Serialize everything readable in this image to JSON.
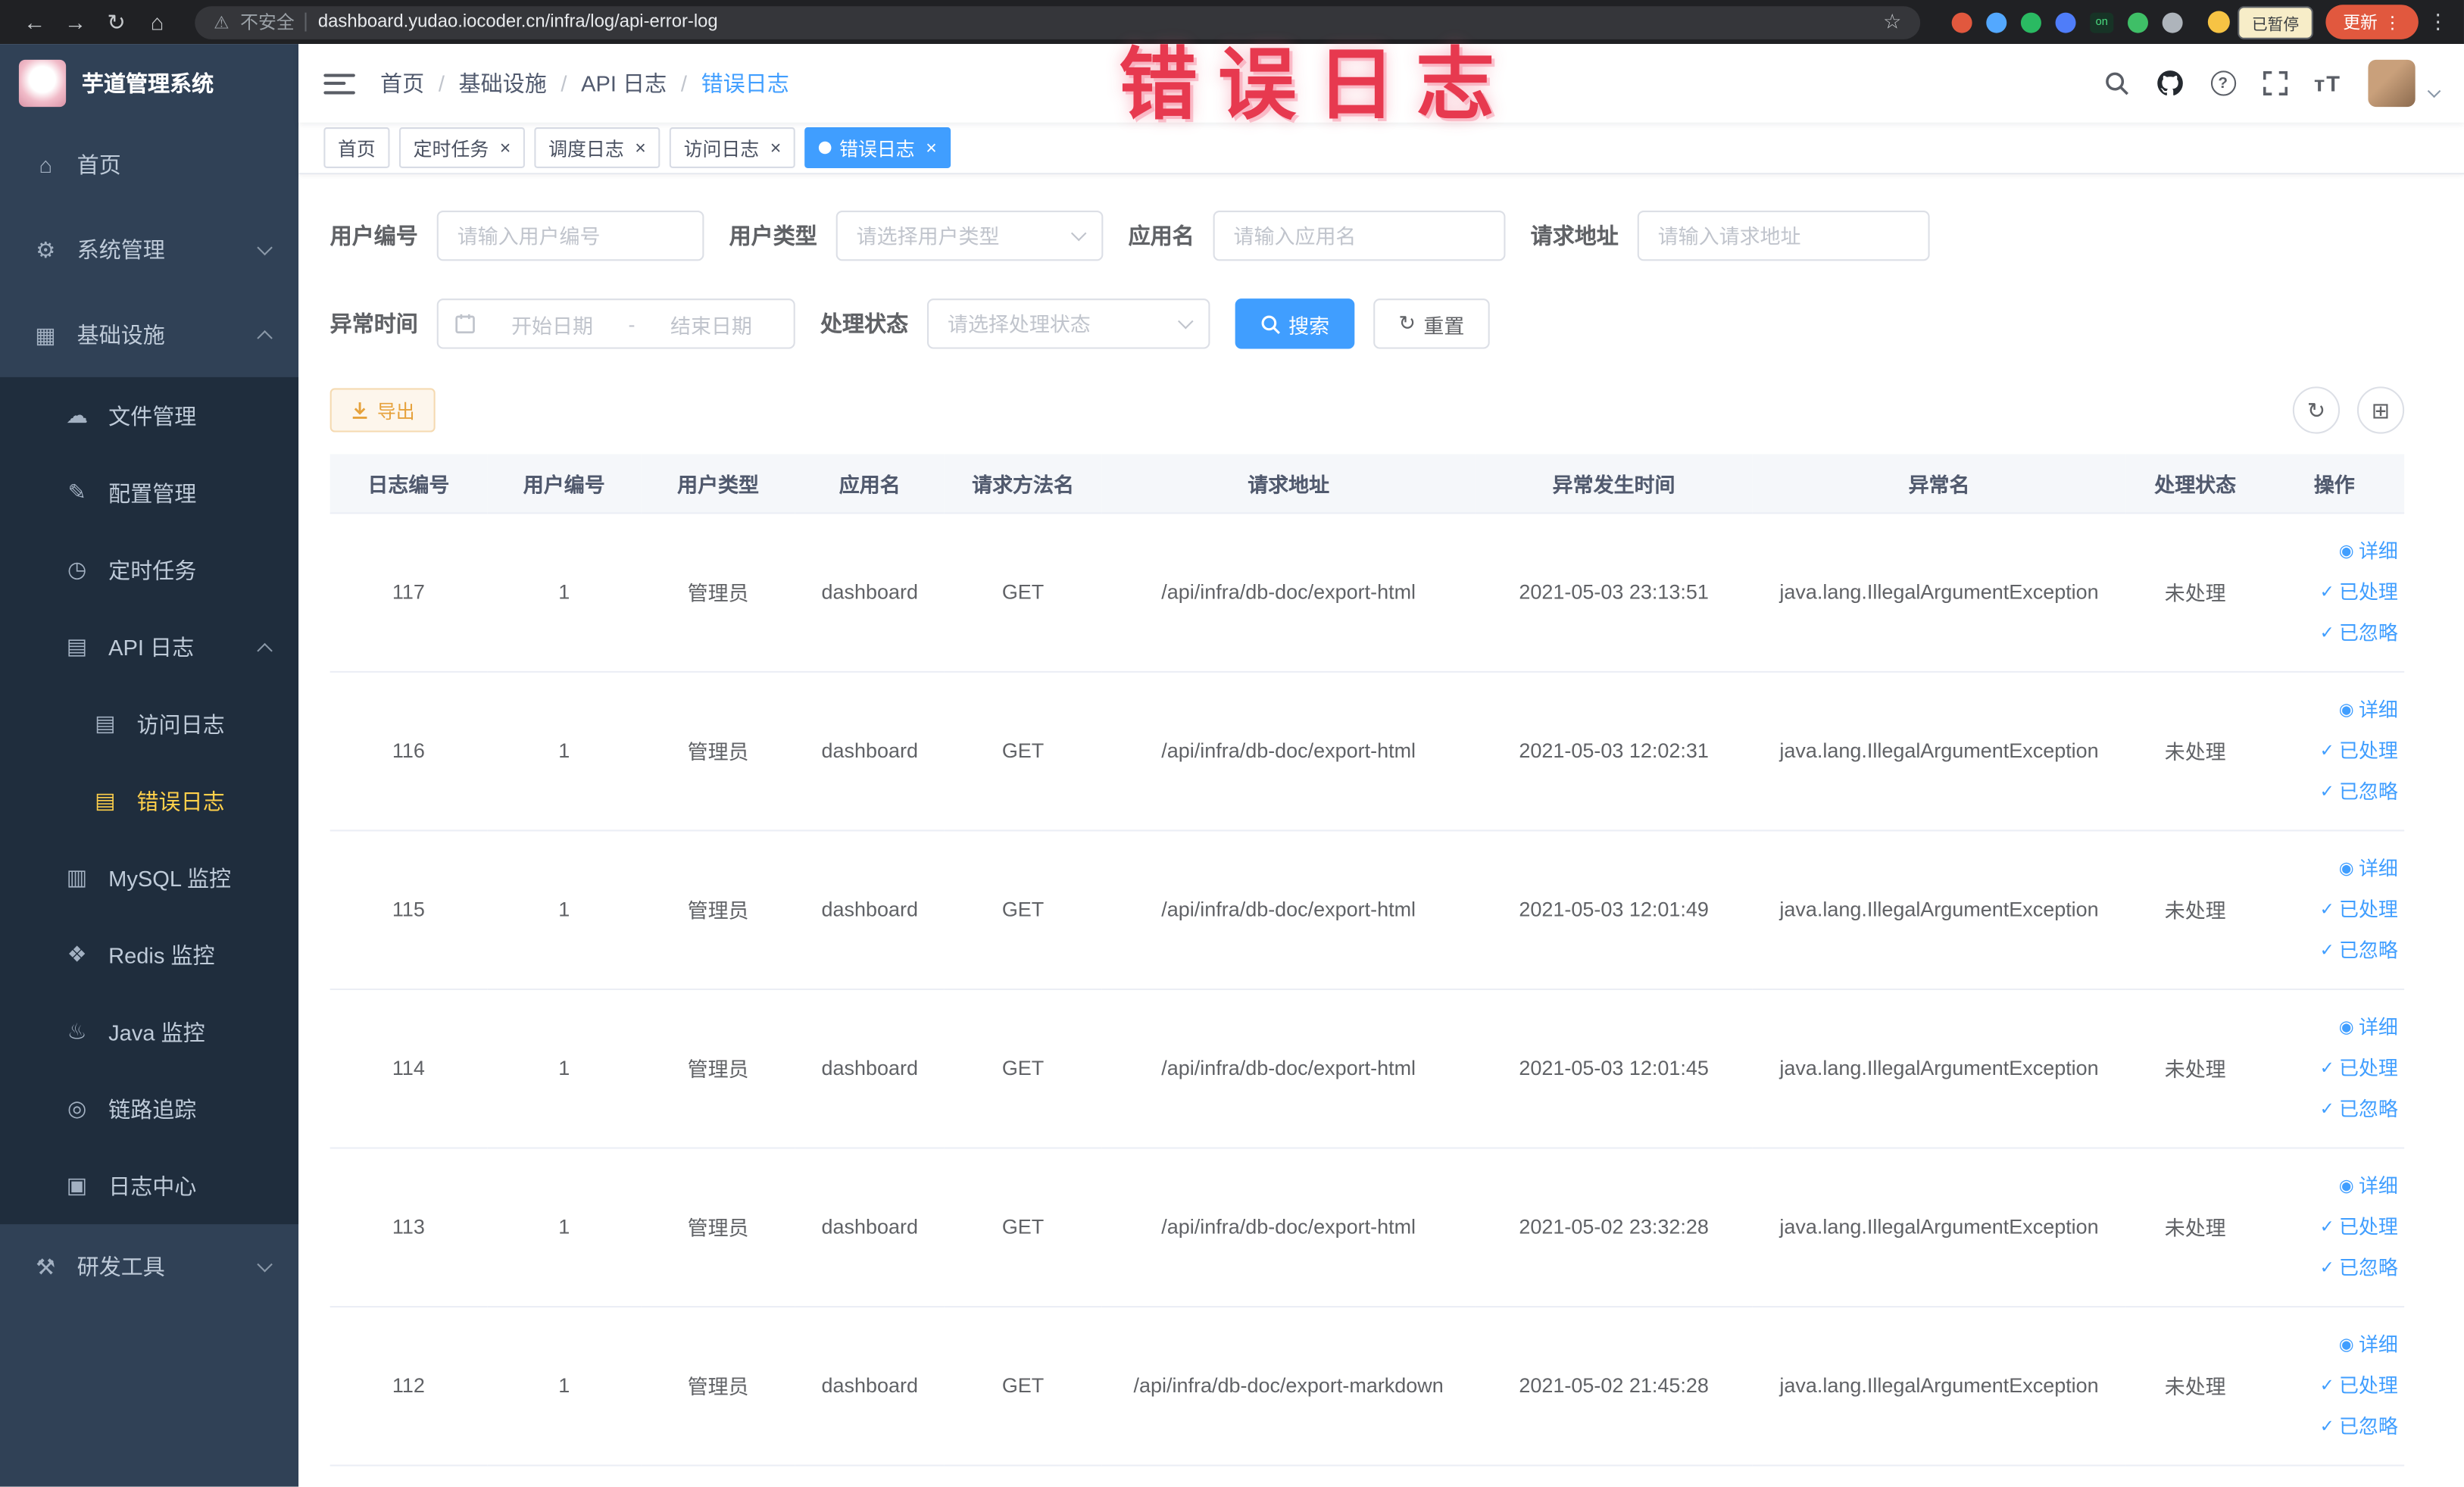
{
  "colors": {
    "accent": "#409eff",
    "sidebar_bg": "#304156",
    "submenu_bg": "#1f2d3d",
    "menu_active": "#ffd04b",
    "warning": "#e6a23c",
    "annotation_red": "#e7394f"
  },
  "browser": {
    "security_label": "不安全",
    "url": "dashboard.yudao.iocoder.cn/infra/log/api-error-log",
    "paused_badge": "已暂停",
    "update_label": "更新",
    "on_badge": "on"
  },
  "annotation": {
    "text": "错误日志"
  },
  "sidebar": {
    "logo_title": "芋道管理系统",
    "items": [
      {
        "label": "首页",
        "glyph": "⌂"
      },
      {
        "label": "系统管理",
        "glyph": "⚙"
      },
      {
        "label": "基础设施",
        "glyph": "▦",
        "children": [
          {
            "label": "文件管理",
            "glyph": "☁"
          },
          {
            "label": "配置管理",
            "glyph": "✎"
          },
          {
            "label": "定时任务",
            "glyph": "◷"
          },
          {
            "label": "API 日志",
            "glyph": "▤",
            "children": [
              {
                "label": "访问日志",
                "glyph": "▤"
              },
              {
                "label": "错误日志",
                "glyph": "▤",
                "active": true
              }
            ]
          },
          {
            "label": "MySQL 监控",
            "glyph": "▥"
          },
          {
            "label": "Redis 监控",
            "glyph": "❖"
          },
          {
            "label": "Java 监控",
            "glyph": "♨"
          },
          {
            "label": "链路追踪",
            "glyph": "◎"
          },
          {
            "label": "日志中心",
            "glyph": "▣"
          }
        ]
      },
      {
        "label": "研发工具",
        "glyph": "⚒"
      }
    ]
  },
  "header": {
    "breadcrumb": [
      "首页",
      "基础设施",
      "API 日志",
      "错误日志"
    ],
    "font_icon_label": "тT"
  },
  "tabs": [
    {
      "label": "首页"
    },
    {
      "label": "定时任务"
    },
    {
      "label": "调度日志"
    },
    {
      "label": "访问日志"
    },
    {
      "label": "错误日志",
      "active": true
    }
  ],
  "filters": {
    "user_id": {
      "label": "用户编号",
      "placeholder": "请输入用户编号"
    },
    "user_type": {
      "label": "用户类型",
      "placeholder": "请选择用户类型"
    },
    "app_name": {
      "label": "应用名",
      "placeholder": "请输入应用名"
    },
    "request_url": {
      "label": "请求地址",
      "placeholder": "请输入请求地址"
    },
    "exception_time": {
      "label": "异常时间",
      "start_placeholder": "开始日期",
      "separator": "-",
      "end_placeholder": "结束日期"
    },
    "process_status": {
      "label": "处理状态",
      "placeholder": "请选择处理状态"
    },
    "search_label": "搜索",
    "reset_label": "重置"
  },
  "toolbar": {
    "export_label": "导出"
  },
  "table": {
    "columns": [
      "日志编号",
      "用户编号",
      "用户类型",
      "应用名",
      "请求方法名",
      "请求地址",
      "异常发生时间",
      "异常名",
      "处理状态",
      "操作"
    ],
    "actions": {
      "detail": "详细",
      "processed": "已处理",
      "ignored": "已忽略"
    },
    "rows": [
      {
        "id": "117",
        "user_id": "1",
        "user_type": "管理员",
        "app": "dashboard",
        "method": "GET",
        "url": "/api/infra/db-doc/export-html",
        "time": "2021-05-03 23:13:51",
        "exception": "java.lang.IllegalArgumentException",
        "status": "未处理"
      },
      {
        "id": "116",
        "user_id": "1",
        "user_type": "管理员",
        "app": "dashboard",
        "method": "GET",
        "url": "/api/infra/db-doc/export-html",
        "time": "2021-05-03 12:02:31",
        "exception": "java.lang.IllegalArgumentException",
        "status": "未处理"
      },
      {
        "id": "115",
        "user_id": "1",
        "user_type": "管理员",
        "app": "dashboard",
        "method": "GET",
        "url": "/api/infra/db-doc/export-html",
        "time": "2021-05-03 12:01:49",
        "exception": "java.lang.IllegalArgumentException",
        "status": "未处理"
      },
      {
        "id": "114",
        "user_id": "1",
        "user_type": "管理员",
        "app": "dashboard",
        "method": "GET",
        "url": "/api/infra/db-doc/export-html",
        "time": "2021-05-03 12:01:45",
        "exception": "java.lang.IllegalArgumentException",
        "status": "未处理"
      },
      {
        "id": "113",
        "user_id": "1",
        "user_type": "管理员",
        "app": "dashboard",
        "method": "GET",
        "url": "/api/infra/db-doc/export-html",
        "time": "2021-05-02 23:32:28",
        "exception": "java.lang.IllegalArgumentException",
        "status": "未处理"
      },
      {
        "id": "112",
        "user_id": "1",
        "user_type": "管理员",
        "app": "dashboard",
        "method": "GET",
        "url": "/api/infra/db-doc/export-markdown",
        "time": "2021-05-02 21:45:28",
        "exception": "java.lang.IllegalArgumentException",
        "status": "未处理"
      }
    ]
  }
}
